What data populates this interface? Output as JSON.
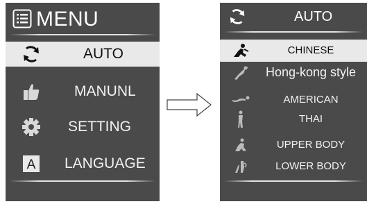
{
  "left_menu": {
    "title": "MENU",
    "items": [
      {
        "label": "AUTO",
        "icon": "rotate-arrows-icon",
        "selected": true
      },
      {
        "label": "MANUNL",
        "icon": "thumbs-up-icon",
        "selected": false
      },
      {
        "label": "SETTING",
        "icon": "gear-icon",
        "selected": false
      },
      {
        "label": "LANGUAGE",
        "icon": "letter-a-icon",
        "selected": false
      }
    ]
  },
  "right_menu": {
    "title": "AUTO",
    "items": [
      {
        "label": "CHINESE",
        "icon": "massage-figure-icon",
        "selected": true
      },
      {
        "label": "Hong-kong style",
        "icon": "stretch-figure-icon",
        "selected": false
      },
      {
        "label": "AMERICAN",
        "icon": "lying-figure-icon",
        "selected": false
      },
      {
        "label": "THAI",
        "icon": "standing-figure-icon",
        "selected": false
      },
      {
        "label": "UPPER BODY",
        "icon": "upper-body-icon",
        "selected": false
      },
      {
        "label": "LOWER BODY",
        "icon": "lower-body-icon",
        "selected": false
      }
    ]
  },
  "colors": {
    "panel_bg": "#4a4a4a",
    "selected_bg": "#e9e9e9",
    "text": "#f2f2f2"
  },
  "arrow_icon": "right-arrow-icon"
}
